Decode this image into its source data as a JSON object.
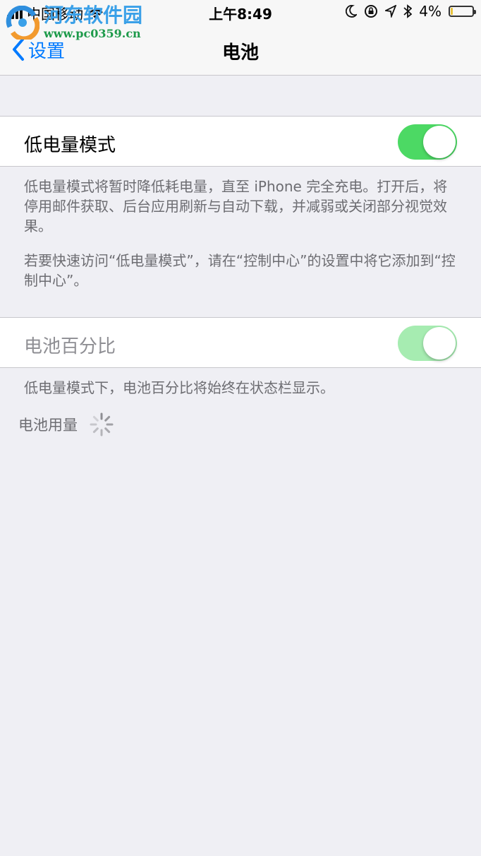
{
  "status_bar": {
    "carrier": "中国移动",
    "time": "上午8:49",
    "battery_percent": "4%",
    "icons": [
      "signal-icon",
      "wifi-icon",
      "moon-icon",
      "rotation-lock-icon",
      "location-icon",
      "bluetooth-icon",
      "battery-icon"
    ]
  },
  "watermark": {
    "title": "河东软件园",
    "url": "www.pc0359.cn"
  },
  "nav": {
    "back_label": "设置",
    "title": "电池"
  },
  "low_power": {
    "label": "低电量模式",
    "enabled": true,
    "description_1": "低电量模式将暂时降低耗电量，直至 iPhone 完全充电。打开后，将停用邮件获取、后台应用刷新与自动下载，并减弱或关闭部分视觉效果。",
    "description_2": "若要快速访问“低电量模式”，请在“控制中心”的设置中将它添加到“控制中心”。"
  },
  "battery_percentage": {
    "label": "电池百分比",
    "enabled": true,
    "disabled_state": true,
    "description": "低电量模式下，电池百分比将始终在状态栏显示。"
  },
  "usage": {
    "label": "电池用量"
  },
  "colors": {
    "accent": "#007aff",
    "toggle_on": "#4cd964",
    "toggle_on_dim": "#a6ecb1",
    "background": "#efeff4",
    "battery_low": "#e8c33b"
  }
}
